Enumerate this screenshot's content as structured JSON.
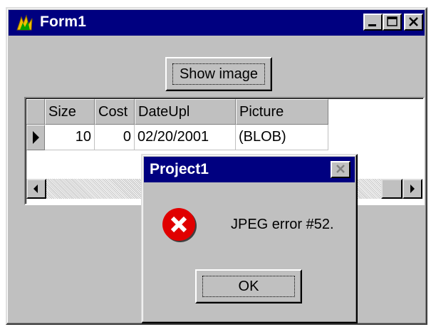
{
  "window": {
    "title": "Form1",
    "icon": "delphi-app-icon",
    "controls": [
      "minimize-icon",
      "maximize-icon",
      "close-icon"
    ]
  },
  "form": {
    "show_image_button": "Show image"
  },
  "grid": {
    "columns": [
      "Size",
      "Cost",
      "DateUpl",
      "Picture"
    ],
    "rows": [
      {
        "indicator": "current-row-arrow-icon",
        "Size": "10",
        "Cost": "0",
        "DateUpl": "02/20/2001",
        "Picture": "(BLOB)"
      }
    ],
    "scrollbar": {
      "left_icon": "arrow-left-icon",
      "right_icon": "arrow-right-icon"
    }
  },
  "dialog": {
    "title": "Project1",
    "icon": "error-icon",
    "message": "JPEG error #52.",
    "ok_button": "OK"
  },
  "colors": {
    "titlebar": "#000080",
    "face": "#c0c0c0",
    "error_red": "#e00000"
  }
}
